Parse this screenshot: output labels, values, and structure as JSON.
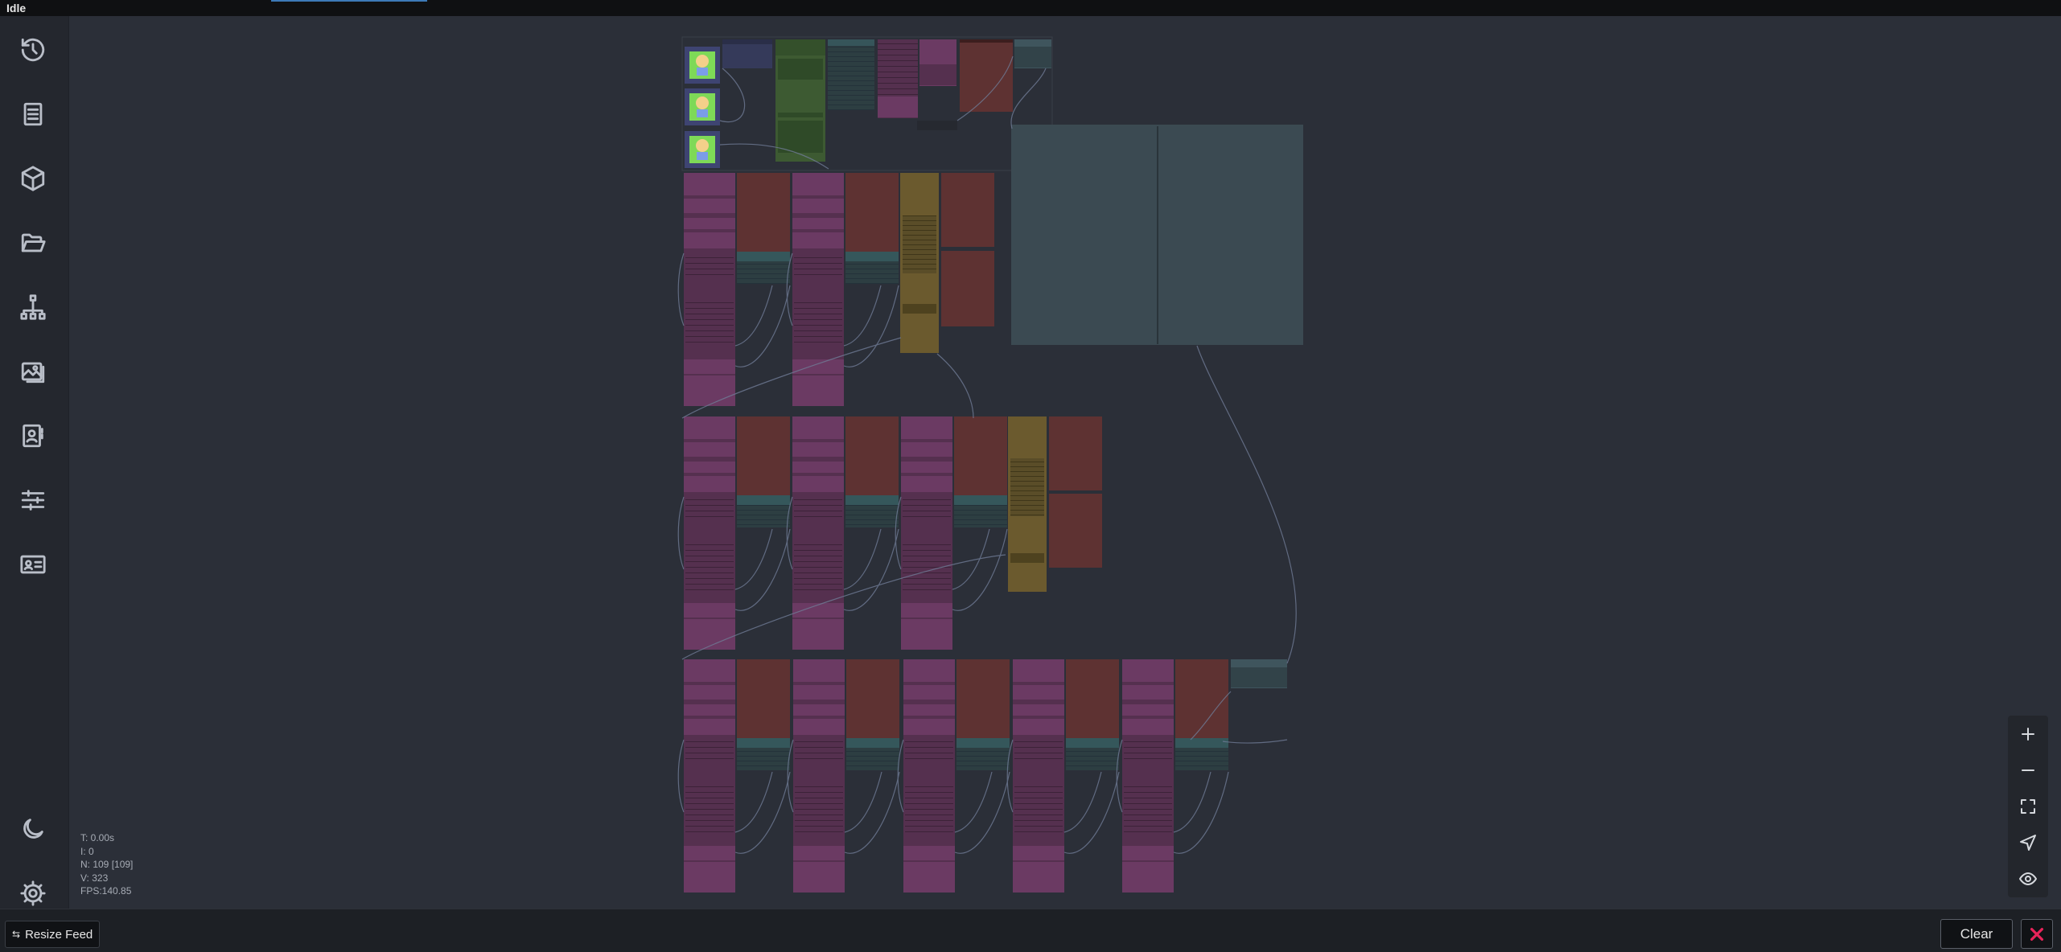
{
  "status": {
    "text": "Idle"
  },
  "sidebar": {
    "items": [
      {
        "icon": "history-icon"
      },
      {
        "icon": "document-icon"
      },
      {
        "icon": "cube-icon"
      },
      {
        "icon": "folder-open-icon"
      },
      {
        "icon": "sitemap-icon"
      },
      {
        "icon": "images-icon"
      },
      {
        "icon": "contact-book-icon"
      },
      {
        "icon": "sliders-icon"
      },
      {
        "icon": "id-card-icon"
      },
      {
        "icon": "moon-icon"
      },
      {
        "icon": "gear-icon"
      }
    ]
  },
  "stats": {
    "t": "T: 0.00s",
    "i": "I: 0",
    "n": "N: 109 [109]",
    "v": "V: 323",
    "fps": "FPS:140.85"
  },
  "zoom": {
    "controls": [
      "plus-icon",
      "minus-icon",
      "fit-view-icon",
      "locate-icon",
      "eye-icon"
    ]
  },
  "bottombar": {
    "resize_feed_label": "Resize Feed",
    "clear_label": "Clear"
  },
  "colors": {
    "node_purple": "#6b3a63",
    "node_red": "#5e3232",
    "node_teal": "#2f4f53",
    "node_green": "#3d5a32",
    "node_yellow": "#6b5a2e",
    "node_blue_gray": "#3f555d",
    "group_slate": "#3b4a52",
    "accent_close": "#e8245a"
  }
}
